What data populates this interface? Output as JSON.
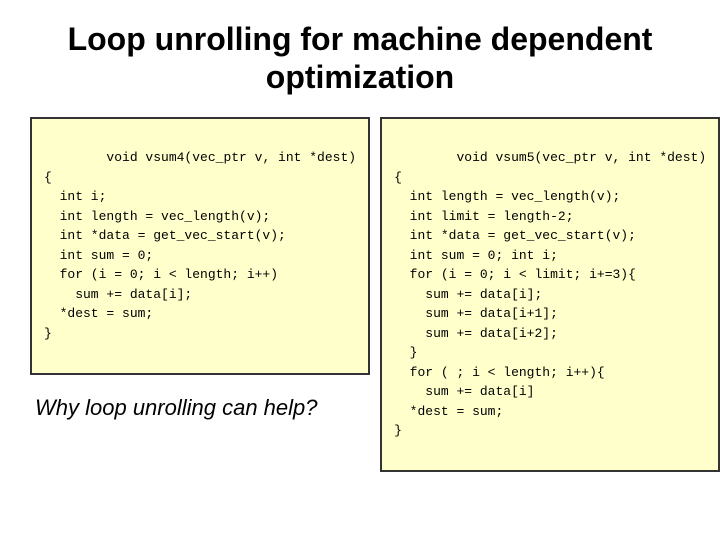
{
  "title": {
    "line1": "Loop unrolling for machine dependent",
    "line2": "optimization"
  },
  "left_code": {
    "content": "void vsum4(vec_ptr v, int *dest)\n{\n  int i;\n  int length = vec_length(v);\n  int *data = get_vec_start(v);\n  int sum = 0;\n  for (i = 0; i < length; i++)\n    sum += data[i];\n  *dest = sum;\n}"
  },
  "why_text": "Why loop unrolling can help?",
  "right_code": {
    "content": "void vsum5(vec_ptr v, int *dest)\n{\n  int length = vec_length(v);\n  int limit = length-2;\n  int *data = get_vec_start(v);\n  int sum = 0; int i;\n  for (i = 0; i < limit; i+=3){\n    sum += data[i];\n    sum += data[i+1];\n    sum += data[i+2];\n  }\n  for ( ; i < length; i++){\n    sum += data[i]\n  *dest = sum;\n}"
  }
}
